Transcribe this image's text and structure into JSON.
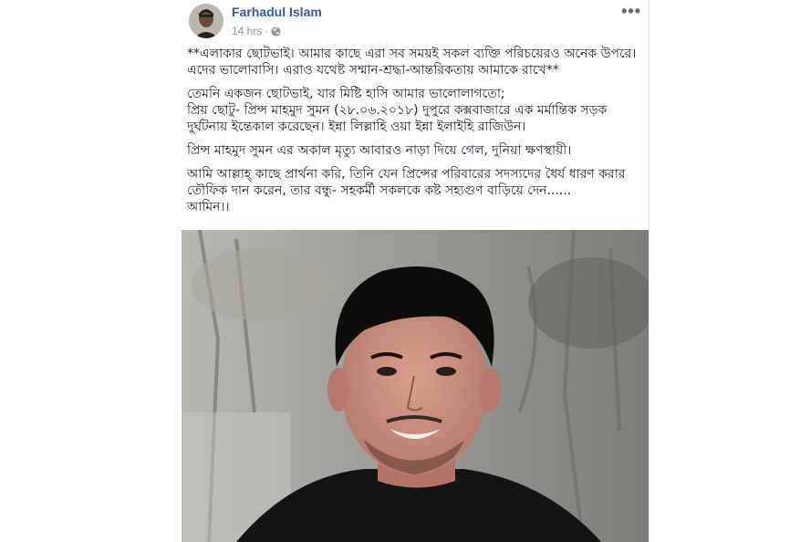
{
  "post": {
    "author": "Farhadul Islam",
    "time": "14 hrs",
    "separator": "·",
    "more_label": "•••",
    "paragraphs": [
      "**এলাকার ছোটভাই। আমার কাছে এরা সব সময়ই সকল ব্যক্তি পরিচয়েরও অনেক উপরে। এদের ভালোবাসি। এরাও যথেষ্ট সম্মান-শ্রদ্ধা-আন্তরিকতায় আমাকে রাখে**",
      "তেমনি একজন ছোটভাই, যার মিষ্টি হাসি আমার ভালোলাগতো;\nপ্রিয় ছোটু- প্রিন্স মাহমুদ সুমন (২৮.০৬.২০১৮) দুপুরে কক্সবাজারে এক মর্মান্তিক সড়ক দুর্ঘটনায় ইন্তেকাল করেছেন। ইন্না লিল্লাহি ওয়া ইন্না ইলাইহি রাজিউন।",
      "প্রিন্স মাহমুদ সুমন এর অকাল মৃত্যু আবারও নাড়া দিয়ে গেল, দুনিয়া ক্ষণস্থায়ী।",
      "আমি আল্লাহ্ কাছে প্রার্থনা করি, তিনি যেন প্রিন্সের পরিবারের সদস্যদের ধৈর্য ধারণ করার তৌফিক দান করেন, তার বন্ধু- সহকর্মী সকলকে কষ্ট সহ্যগুণ বাড়িয়ে দেন......\nআমিন।।"
    ]
  },
  "icons": {
    "avatar": "profile-avatar",
    "privacy": "globe-icon",
    "more": "more-options-icon"
  },
  "colors": {
    "author_link": "#365899",
    "meta_gray": "#90949c",
    "text": "#1d2129"
  }
}
